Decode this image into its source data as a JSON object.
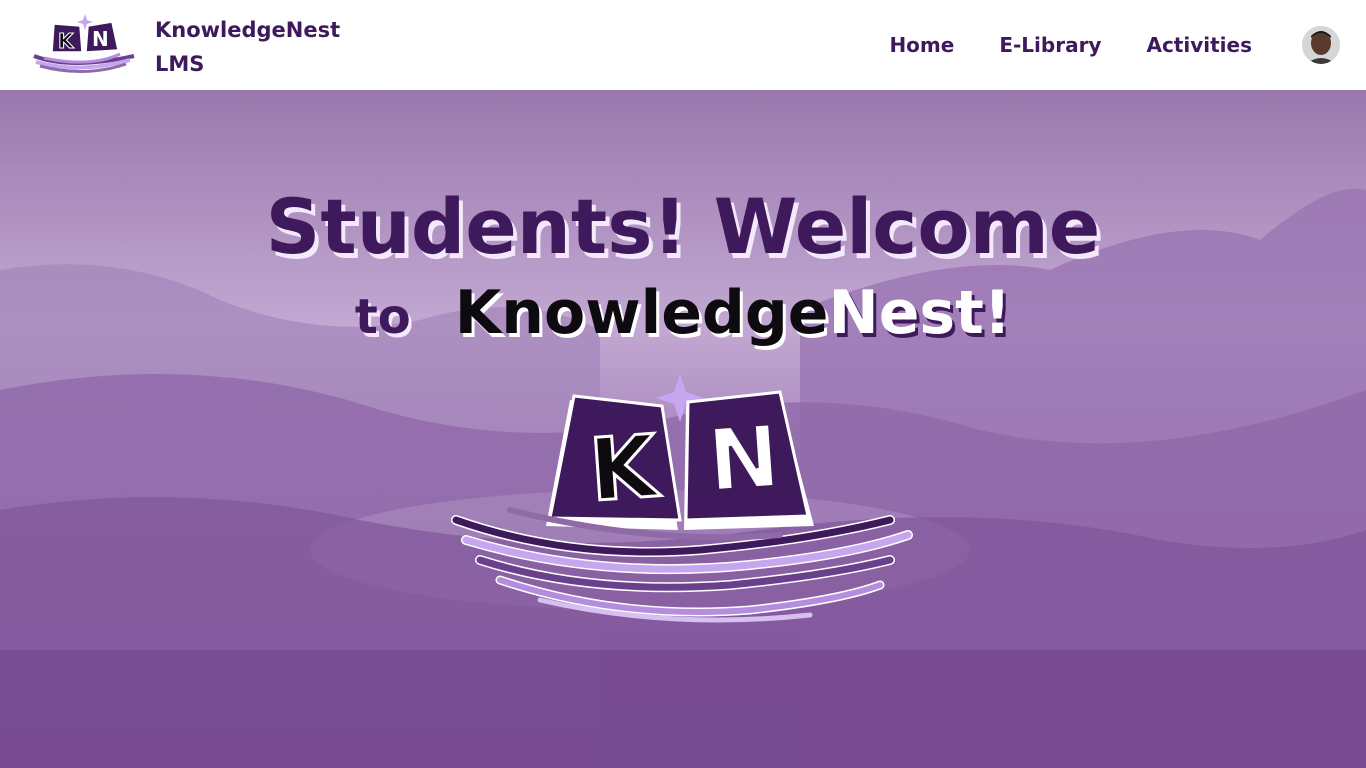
{
  "header": {
    "brand_name": "KnowledgeNest LMS",
    "logo_letters": {
      "left": "K",
      "right": "N"
    },
    "nav": [
      {
        "label": "Home"
      },
      {
        "label": "E-Library"
      },
      {
        "label": "Activities"
      }
    ],
    "avatar_icon": "user-avatar"
  },
  "hero": {
    "headline": "Students! Welcome",
    "sub_to": "to",
    "sub_knowledge": "Knowledge",
    "sub_nest": "Nest!",
    "logo_letters": {
      "left": "K",
      "right": "N"
    }
  },
  "colors": {
    "brand_purple": "#3e1a5c",
    "hero_purple": "#8e6aa6",
    "accent_lavender": "#c7a6f0"
  }
}
